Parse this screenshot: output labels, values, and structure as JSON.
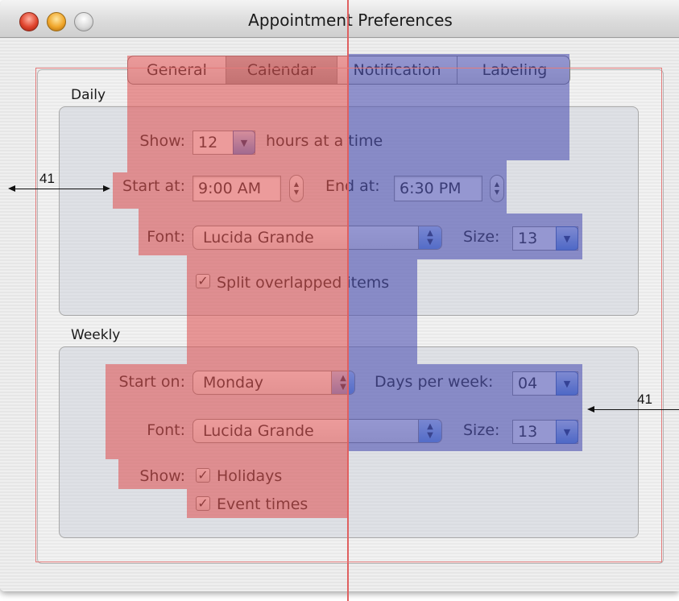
{
  "window": {
    "title": "Appointment Preferences"
  },
  "tabs": [
    {
      "label": "General",
      "selected": false
    },
    {
      "label": "Calendar",
      "selected": true
    },
    {
      "label": "Notification",
      "selected": false
    },
    {
      "label": "Labeling",
      "selected": false
    }
  ],
  "daily": {
    "group_label": "Daily",
    "show_label": "Show:",
    "show_value": "12",
    "hours_label": "hours at a time",
    "start_label": "Start at:",
    "start_value": "9:00 AM",
    "end_label": "End at:",
    "end_value": "6:30 PM",
    "font_label": "Font:",
    "font_value": "Lucida Grande",
    "size_label": "Size:",
    "size_value": "13",
    "split_label": "Split overlapped items",
    "split_checked": true
  },
  "weekly": {
    "group_label": "Weekly",
    "start_on_label": "Start on:",
    "start_on_value": "Monday",
    "days_label": "Days per week:",
    "days_value": "04",
    "font_label": "Font:",
    "font_value": "Lucida Grande",
    "size_label": "Size:",
    "size_value": "13",
    "show_label": "Show:",
    "holidays_label": "Holidays",
    "holidays_checked": true,
    "event_times_label": "Event times",
    "event_times_checked": true
  },
  "annotations": {
    "left_margin_text": "41",
    "right_margin_text": "41"
  },
  "colors": {
    "overlay_left": "#de5252",
    "overlay_right": "#4e52b2",
    "guide_line": "#e06060"
  }
}
